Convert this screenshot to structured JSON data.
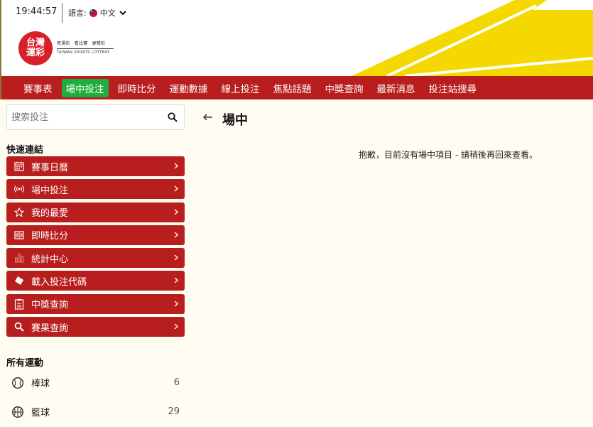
{
  "header": {
    "time": "19:44:57",
    "language_label": "語言:",
    "language_value": "中文",
    "logo_line1": "台灣",
    "logo_line2": "運彩",
    "logo_slogan": "買運彩　看比賽　更精彩",
    "logo_en": "TAIWAN SPORTS LOTTERY",
    "stripe_color": "#f5d800"
  },
  "nav": {
    "items": [
      {
        "label": "賽事表"
      },
      {
        "label": "場中投注",
        "active": true
      },
      {
        "label": "即時比分"
      },
      {
        "label": "運動數據"
      },
      {
        "label": "線上投注"
      },
      {
        "label": "焦點話題"
      },
      {
        "label": "中獎查詢"
      },
      {
        "label": "最新消息"
      },
      {
        "label": "投注站搜尋"
      }
    ],
    "bg_color": "#b81e1e",
    "active_color": "#1fae3e"
  },
  "sidebar": {
    "search_placeholder": "搜索投注",
    "quick_links_title": "快速連結",
    "quick_links": [
      {
        "label": "賽事日曆",
        "icon": "calendar-icon"
      },
      {
        "label": "場中投注",
        "icon": "live-broadcast-icon"
      },
      {
        "label": "我的最愛",
        "icon": "star-icon"
      },
      {
        "label": "即時比分",
        "icon": "scoreboard-icon"
      },
      {
        "label": "統計中心",
        "icon": "bar-chart-icon"
      },
      {
        "label": "載入投注代碼",
        "icon": "ticket-icon"
      },
      {
        "label": "中獎查詢",
        "icon": "clipboard-icon"
      },
      {
        "label": "賽果查詢",
        "icon": "search-icon"
      }
    ],
    "all_sports_title": "所有運動",
    "sports": [
      {
        "label": "棒球",
        "count": "6",
        "icon": "baseball-icon"
      },
      {
        "label": "籃球",
        "count": "29",
        "icon": "basketball-icon"
      }
    ]
  },
  "main": {
    "title": "場中",
    "empty_message": "抱歉，目前沒有場中項目 - 請稍後再回來查看。"
  }
}
